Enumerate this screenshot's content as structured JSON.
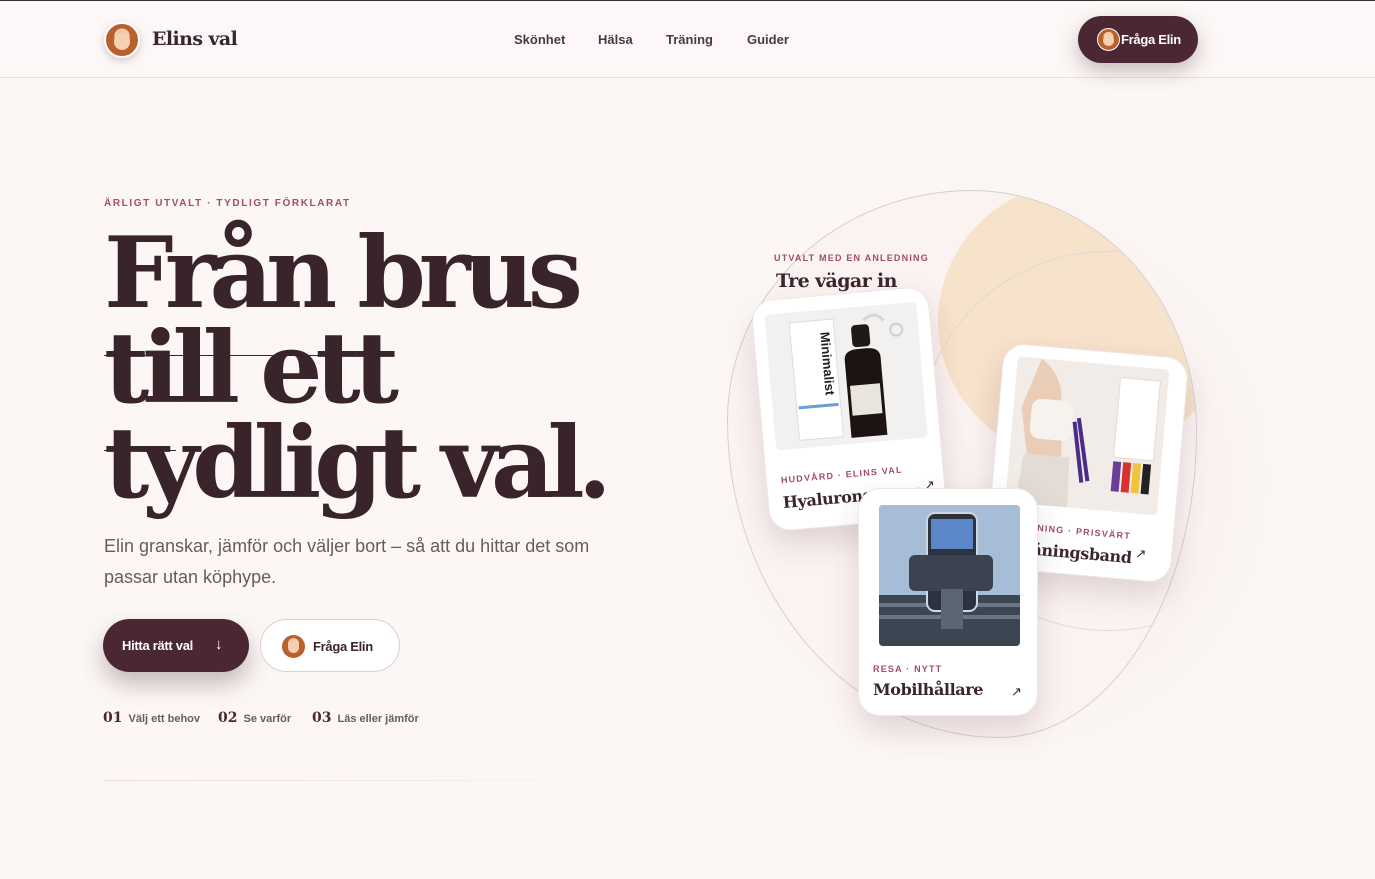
{
  "header": {
    "logo_text": "Elins val",
    "nav": [
      "Skönhet",
      "Hälsa",
      "Träning",
      "Guider"
    ],
    "cta_label": "Fråga Elin"
  },
  "hero": {
    "eyebrow": "ÄRLIGT UTVALT · TYDLIGT FÖRKLARAT",
    "headline": [
      "Från brus",
      "till ett",
      "tydligt val."
    ],
    "lead": "Elin granskar, jämför och väljer bort – så att du hittar det som passar utan köphype.",
    "primary_cta": "Hitta rätt val",
    "secondary_cta": "Fråga Elin",
    "steps": [
      {
        "num": "01",
        "label": "Välj ett behov"
      },
      {
        "num": "02",
        "label": "Se varför"
      },
      {
        "num": "03",
        "label": "Läs eller jämför"
      }
    ]
  },
  "panel": {
    "eyebrow": "UTVALT MED EN ANLEDNING",
    "title": "Tre vägar in",
    "cards": [
      {
        "tag": "HUDVÅRD · ELINS VAL",
        "name": "Hyaluronsyra-se...",
        "image": "serum-bottle",
        "brand": "Minimalist"
      },
      {
        "tag": "TRÄNING · PRISVÄRT",
        "name": "Träningsband",
        "image": "resistance-bands"
      },
      {
        "tag": "RESA · NYTT",
        "name": "Mobilhållare",
        "image": "phone-holder"
      }
    ]
  },
  "colors": {
    "background": "#fcf7f5",
    "primary": "#4a2733",
    "accent": "#a24f63",
    "peach": "#f7e2cb"
  }
}
